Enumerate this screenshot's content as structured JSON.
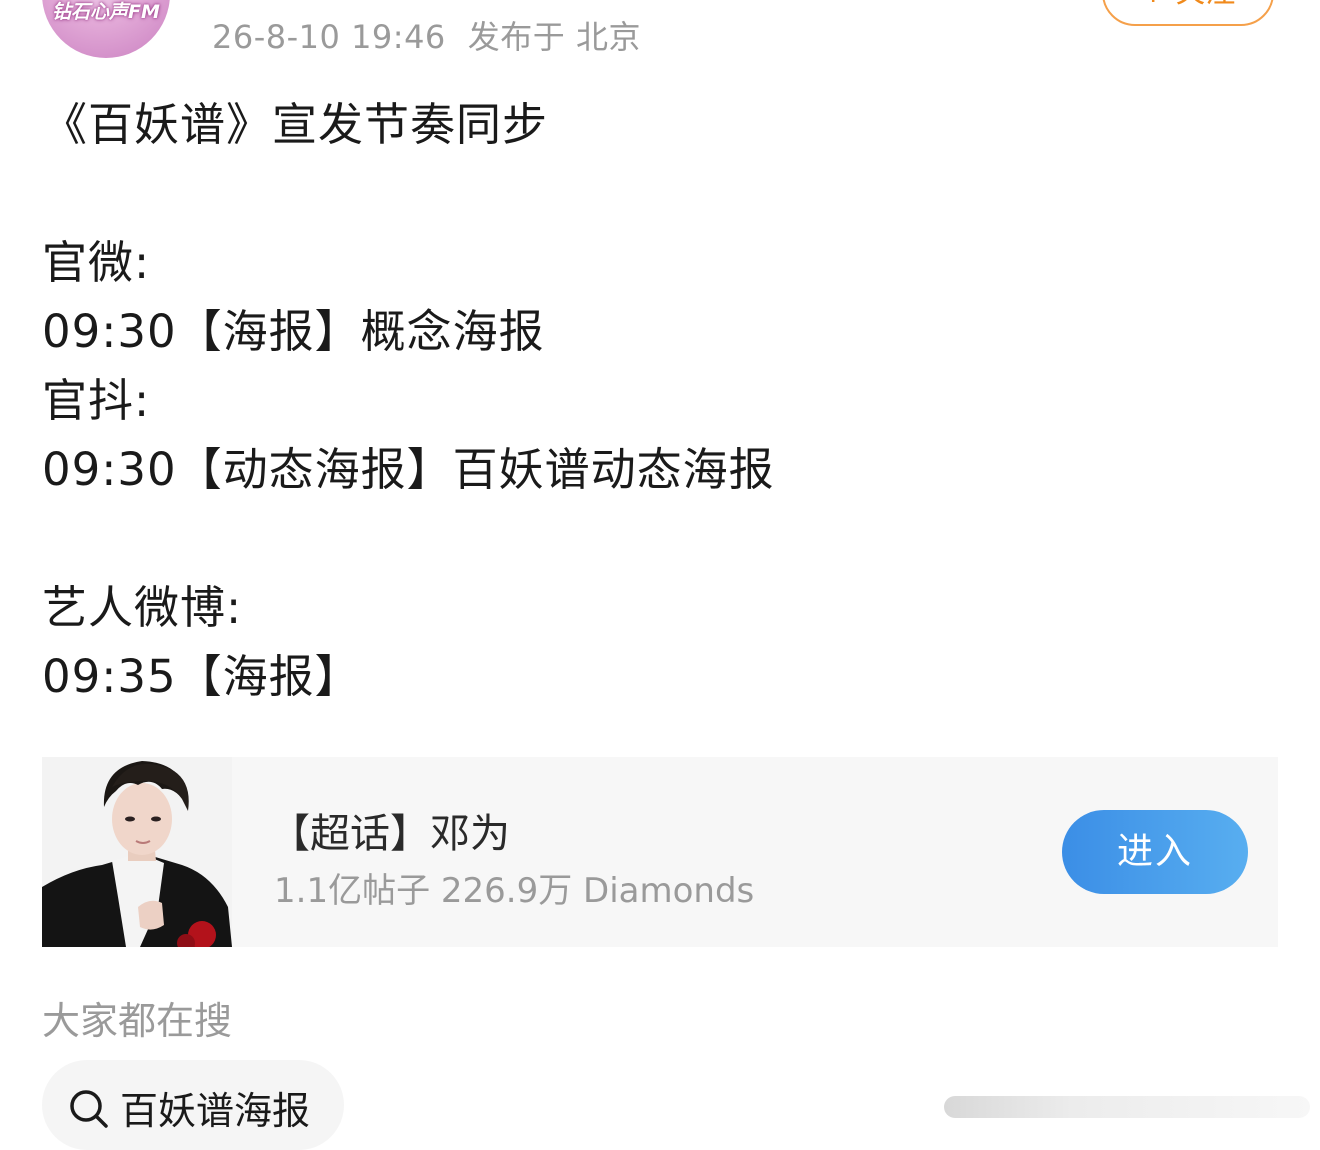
{
  "header": {
    "avatar_text": "钻石心声FM",
    "timestamp": "26-8-10 19:46",
    "location_text": "发布于 北京",
    "follow_label": "+ 关注"
  },
  "post": {
    "lines": [
      "《百妖谱》宣发节奏同步",
      "",
      "官微:",
      "09:30【海报】概念海报",
      "官抖:",
      "09:30【动态海报】百妖谱动态海报",
      "",
      "艺人微博:",
      "09:35【海报】"
    ]
  },
  "topic_card": {
    "title": "【超话】邓为",
    "stats": "1.1亿帖子 226.9万 Diamonds",
    "enter_label": "进入"
  },
  "search": {
    "heading": "大家都在搜",
    "chip_text": "百妖谱海报",
    "icon": "search-icon"
  },
  "colors": {
    "accent_blue": "#4a9de9",
    "follow_orange": "#f08a1c",
    "meta_gray": "#9a9a9a"
  }
}
